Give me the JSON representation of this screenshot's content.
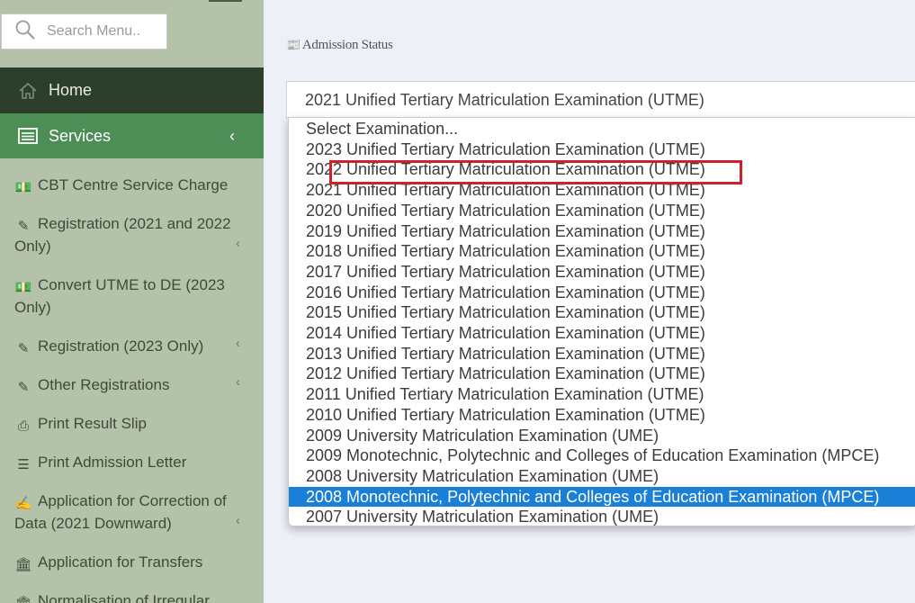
{
  "sidebar": {
    "search_placeholder": "Search Menu..",
    "home_label": "Home",
    "services_label": "Services",
    "items": [
      {
        "label": "CBT Centre Service Charge",
        "icon": "money-icon",
        "has_chevron": false
      },
      {
        "label": "Registration (2021 and 2022 Only)",
        "icon": "edit-icon",
        "has_chevron": true
      },
      {
        "label": "Convert UTME to DE (2023 Only)",
        "icon": "money-icon",
        "has_chevron": false
      },
      {
        "label": "Registration (2023 Only)",
        "icon": "edit-icon",
        "has_chevron": true
      },
      {
        "label": "Other Registrations",
        "icon": "edit-icon",
        "has_chevron": true
      },
      {
        "label": "Print Result Slip",
        "icon": "printer-icon",
        "has_chevron": false
      },
      {
        "label": "Print Admission Letter",
        "icon": "document-icon",
        "has_chevron": false
      },
      {
        "label": "Application for Correction of Data (2021 Downward)",
        "icon": "pencil-square-icon",
        "has_chevron": true
      },
      {
        "label": "Application for Transfers",
        "icon": "bank-icon",
        "has_chevron": false
      },
      {
        "label": "Normalisation of Irregular",
        "icon": "bank-icon",
        "has_chevron": false
      }
    ]
  },
  "main": {
    "heading": "Admission Status",
    "select_value": "2021 Unified Tertiary Matriculation Examination (UTME)",
    "options": [
      "Select Examination...",
      "2023 Unified Tertiary Matriculation Examination (UTME)",
      "2022 Unified Tertiary Matriculation Examination (UTME)",
      "2021 Unified Tertiary Matriculation Examination (UTME)",
      "2020 Unified Tertiary Matriculation Examination (UTME)",
      "2019 Unified Tertiary Matriculation Examination (UTME)",
      "2018 Unified Tertiary Matriculation Examination (UTME)",
      "2017 Unified Tertiary Matriculation Examination (UTME)",
      "2016 Unified Tertiary Matriculation Examination (UTME)",
      "2015 Unified Tertiary Matriculation Examination (UTME)",
      "2014 Unified Tertiary Matriculation Examination (UTME)",
      "2013 Unified Tertiary Matriculation Examination (UTME)",
      "2012 Unified Tertiary Matriculation Examination (UTME)",
      "2011 Unified Tertiary Matriculation Examination (UTME)",
      "2010 Unified Tertiary Matriculation Examination (UTME)",
      "2009 University Matriculation Examination (UME)",
      "2009 Monotechnic, Polytechnic and Colleges of Education Examination (MPCE)",
      "2008 University Matriculation Examination (UME)",
      "2008 Monotechnic, Polytechnic and Colleges of Education Examination (MPCE)",
      "2007 University Matriculation Examination (UME)"
    ],
    "selected_index": 18,
    "highlighted_index": 2
  },
  "colors": {
    "sidebar_bg": "#b3c2a9",
    "home_bg": "#2c3f2c",
    "services_bg": "#4d8e56",
    "selected_option_bg": "#1a7fd6",
    "highlight_border": "#d0202a"
  }
}
